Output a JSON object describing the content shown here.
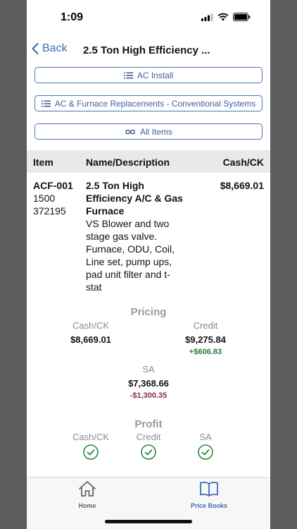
{
  "status": {
    "time": "1:09"
  },
  "nav": {
    "back_label": "Back",
    "title": "2.5 Ton High Efficiency ..."
  },
  "filters": [
    {
      "label": "AC Install",
      "icon": "list-icon"
    },
    {
      "label": "AC & Furnace Replacements - Conventional Systems",
      "icon": "list-icon"
    },
    {
      "label": "All Items",
      "icon": "infinity-icon"
    }
  ],
  "table": {
    "headers": {
      "item": "Item",
      "name": "Name/Description",
      "cash": "Cash/CK"
    },
    "row": {
      "code": "ACF-001",
      "code2": "1500",
      "code3": "372195",
      "name_lines": [
        "2.5 Ton High",
        "Efficiency A/C & Gas",
        "Furnace"
      ],
      "desc_lines": [
        "VS Blower and two",
        "stage gas valve.",
        "Furnace, ODU, Coil,",
        "Line set, pump ups,",
        "pad unit filter and t-",
        "stat"
      ],
      "cash": "$8,669.01"
    }
  },
  "pricing": {
    "title": "Pricing",
    "cash_label": "Cash/CK",
    "cash_value": "$8,669.01",
    "credit_label": "Credit",
    "credit_value": "$9,275.84",
    "credit_delta": "+$606.83",
    "sa_label": "SA",
    "sa_value": "$7,368.66",
    "sa_delta": "-$1,300.35"
  },
  "profit": {
    "title": "Profit",
    "cash_label": "Cash/CK",
    "credit_label": "Credit",
    "sa_label": "SA"
  },
  "tabs": {
    "home": "Home",
    "price_books": "Price Books"
  },
  "colors": {
    "accent": "#3d6db5",
    "positive": "#2a7a3a",
    "negative": "#8a2d55",
    "check": "#2a8a3a"
  }
}
